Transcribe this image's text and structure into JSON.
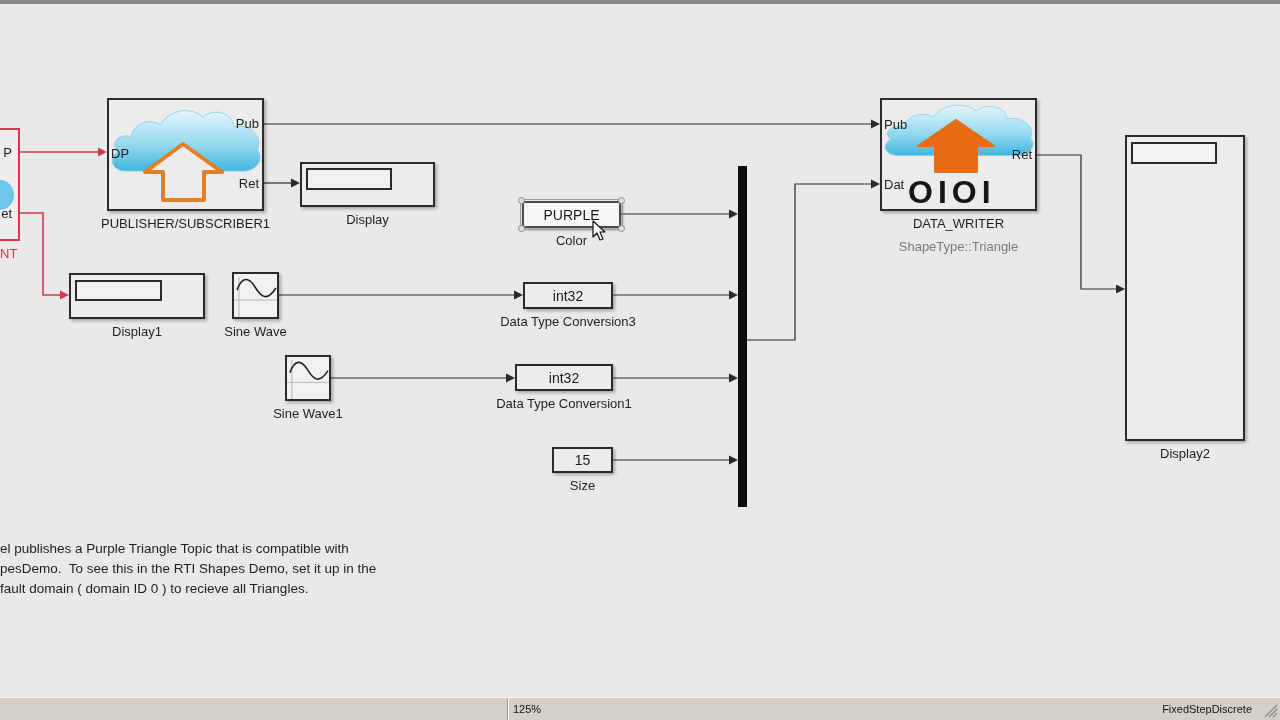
{
  "diagram": {
    "blocks": [
      {
        "kind": "cut_block",
        "ports": [
          {
            "label": "P"
          },
          {
            "label": "et"
          }
        ],
        "name": "NT",
        "highlighted": true,
        "selected": false
      },
      {
        "kind": "publisher_subscriber",
        "ports": [
          {
            "label": "Pub"
          },
          {
            "label": "DP"
          },
          {
            "label": "Ret"
          }
        ],
        "name": "PUBLISHER/SUBSCRIBER1",
        "highlighted": false,
        "selected": false
      },
      {
        "kind": "display",
        "name": "Display",
        "highlighted": false,
        "selected": false
      },
      {
        "kind": "display",
        "name": "Display1",
        "highlighted": false,
        "selected": false
      },
      {
        "kind": "sine_wave",
        "name": "Sine Wave",
        "highlighted": false,
        "selected": false
      },
      {
        "kind": "sine_wave",
        "name": "Sine Wave1",
        "highlighted": false,
        "selected": false
      },
      {
        "kind": "constant",
        "value": "PURPLE",
        "name": "Color",
        "highlighted": false,
        "selected": true
      },
      {
        "kind": "data_type_conversion",
        "value": "int32",
        "name": "Data Type Conversion3",
        "highlighted": false,
        "selected": false
      },
      {
        "kind": "data_type_conversion",
        "value": "int32",
        "name": "Data Type Conversion1",
        "highlighted": false,
        "selected": false
      },
      {
        "kind": "constant",
        "value": "15",
        "name": "Size",
        "highlighted": false,
        "selected": false
      },
      {
        "kind": "bus_creator",
        "highlighted": false,
        "selected": false
      },
      {
        "kind": "data_writer",
        "icon_text": "OIOI",
        "ports": [
          {
            "label": "Pub"
          },
          {
            "label": "Ret"
          },
          {
            "label": "Dat"
          }
        ],
        "name": "DATA_WRITER",
        "subtitle": "ShapeType::Triangle",
        "highlighted": false,
        "selected": false
      },
      {
        "kind": "display",
        "name": "Display2",
        "highlighted": false,
        "selected": false
      }
    ],
    "annotation": {
      "lines": [
        "el publishes a Purple Triangle Topic that is compatible with",
        "pesDemo.  To see this in the RTI Shapes Demo, set it up in the",
        "fault domain ( domain ID 0 ) to recieve all Triangles."
      ]
    }
  },
  "status_bar": {
    "zoom": "125%",
    "solver": "FixedStepDiscrete"
  }
}
